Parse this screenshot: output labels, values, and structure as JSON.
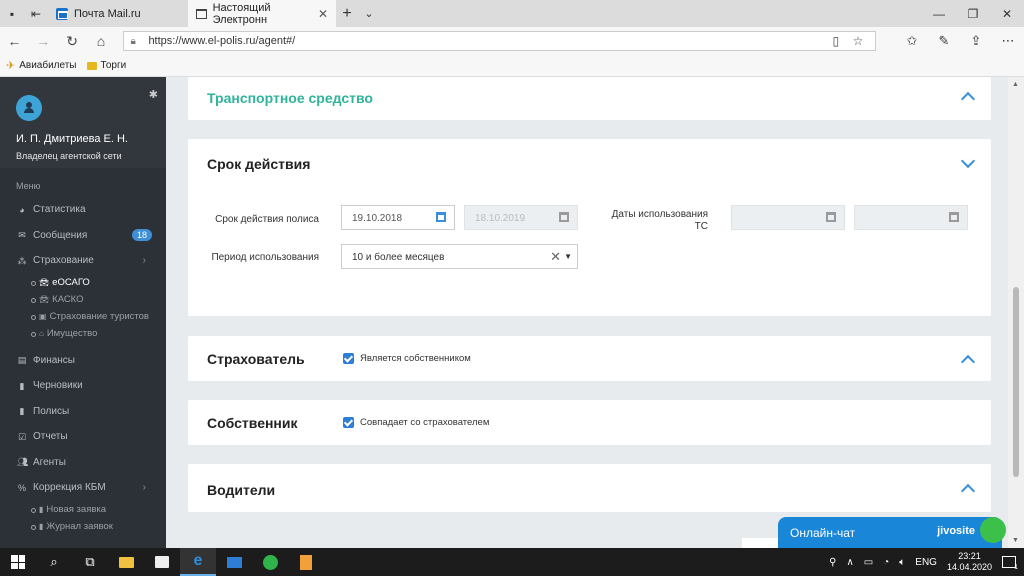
{
  "browser": {
    "tabs": [
      {
        "label": "Почта Mail.ru",
        "active": false
      },
      {
        "label": "Настоящий Электронн",
        "active": true
      }
    ],
    "url": "https://www.el-polis.ru/agent#/",
    "favorites": [
      {
        "label": "Авиабилеты",
        "icon": "plane-icon"
      },
      {
        "label": "Торги",
        "icon": "folder-icon"
      }
    ]
  },
  "sidebar": {
    "user_name": "И. П. Дмитриева Е. Н.",
    "user_role": "Владелец агентской сети",
    "menu_header": "Меню",
    "items": [
      {
        "label": "Статистика",
        "icon": "pie-chart-icon"
      },
      {
        "label": "Сообщения",
        "icon": "envelope-icon",
        "badge": "18"
      },
      {
        "label": "Страхование",
        "icon": "cubes-icon",
        "has_arrow": true
      },
      {
        "label": "Финансы",
        "icon": "money-icon"
      },
      {
        "label": "Черновики",
        "icon": "file-icon"
      },
      {
        "label": "Полисы",
        "icon": "file-text-icon"
      },
      {
        "label": "Отчеты",
        "icon": "check-square-icon"
      },
      {
        "label": "Агенты",
        "icon": "users-icon"
      },
      {
        "label": "Коррекция КБМ",
        "icon": "percent-icon",
        "has_arrow": true
      }
    ],
    "insurance_sub": [
      {
        "label": "еОСАГО",
        "icon": "car-icon",
        "active": true
      },
      {
        "label": "КАСКО",
        "icon": "car-icon",
        "active": false
      },
      {
        "label": "Страхование туристов",
        "icon": "suitcase-icon",
        "active": false
      },
      {
        "label": "Имущество",
        "icon": "home-icon",
        "active": false
      }
    ],
    "kbm_sub": [
      {
        "label": "Новая заявка",
        "icon": "file-icon"
      },
      {
        "label": "Журнал заявок",
        "icon": "file-icon"
      }
    ]
  },
  "sections": {
    "vehicle": {
      "title": "Транспортное средство",
      "expanded": true
    },
    "validity": {
      "title": "Срок действия",
      "policy_term_label": "Срок действия полиса",
      "date_from": "19.10.2018",
      "date_to": "18.10.2019",
      "usage_dates_label": "Даты использования ТС",
      "usage_period_label": "Период использования",
      "usage_period_value": "10 и более месяцев"
    },
    "insurer": {
      "title": "Страхователь",
      "checkbox_label": "Является собственником",
      "checked": true
    },
    "owner": {
      "title": "Собственник",
      "checkbox_label": "Совпадает со страхователем",
      "checked": true
    },
    "drivers": {
      "title": "Водители"
    }
  },
  "chat": {
    "label": "Онлайн-чат",
    "brand": "jivosite"
  },
  "taskbar": {
    "lang": "ENG",
    "time": "23:21",
    "date": "14.04.2020",
    "notif_count": "1"
  },
  "colors": {
    "sidebar_bg": "#2c3138",
    "accent_blue": "#3a8fd9",
    "teal_title": "#2fb39a",
    "chat_blue": "#1a86d8",
    "badge_blue": "#3e8fd8"
  }
}
